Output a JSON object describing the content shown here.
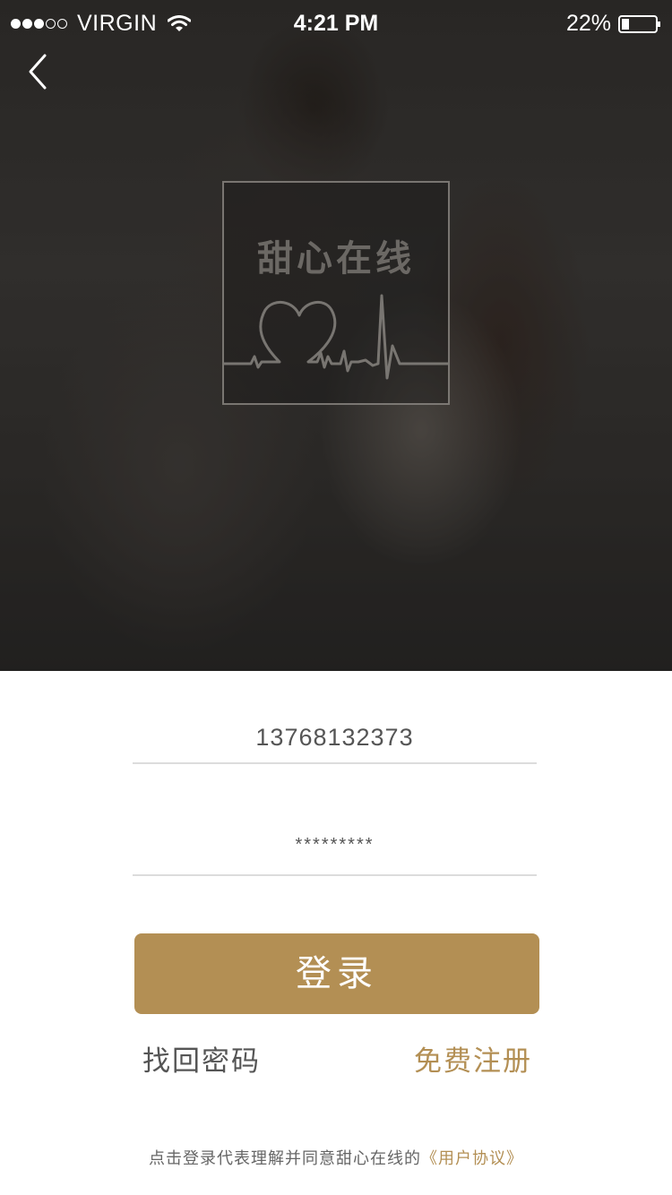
{
  "status_bar": {
    "carrier": "VIRGIN",
    "time": "4:21 PM",
    "battery_percent": "22%",
    "signal_filled": 3,
    "signal_total": 5
  },
  "hero": {
    "logo_title": "甜心在线",
    "logo_icon": "heart-pulse-icon"
  },
  "login_form": {
    "phone_value": "13768132373",
    "password_value": "*********",
    "login_button": "登录",
    "forgot_password": "找回密码",
    "register": "免费注册",
    "agreement_text": "点击登录代表理解并同意甜心在线的",
    "agreement_link": "《用户协议》"
  },
  "colors": {
    "accent": "#b38f54",
    "text": "#555555",
    "divider": "#dcdcdc"
  }
}
